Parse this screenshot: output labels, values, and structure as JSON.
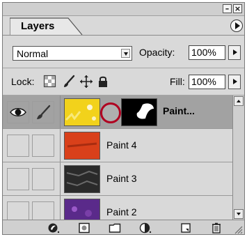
{
  "panel": {
    "tab_label": "Layers",
    "blend_mode": "Normal",
    "opacity_label": "Opacity:",
    "opacity_value": "100%",
    "lock_label": "Lock:",
    "fill_label": "Fill:",
    "fill_value": "100%"
  },
  "layers": [
    {
      "name": "Paint...",
      "selected": true,
      "visible": true,
      "linked": true,
      "thumb_color": "#f2d21b"
    },
    {
      "name": "Paint 4",
      "selected": false,
      "visible": false,
      "linked": false,
      "thumb_color": "#d9401a"
    },
    {
      "name": "Paint 3",
      "selected": false,
      "visible": false,
      "linked": false,
      "thumb_color": "#2a2a2a"
    },
    {
      "name": "Paint 2",
      "selected": false,
      "visible": false,
      "linked": false,
      "thumb_color": "#5a2a8a"
    }
  ],
  "colors": {
    "panel_bg": "#d9d9d9",
    "selected_row": "#a2a2a2",
    "highlight": "#b00020"
  },
  "icons": {
    "lock_transparency": "checkerboard-icon",
    "lock_image": "brush-icon",
    "lock_position": "move-icon",
    "lock_all": "padlock-icon",
    "toolbar": [
      "layer-style-icon",
      "add-mask-icon",
      "new-set-icon",
      "adjustment-layer-icon",
      "new-layer-icon",
      "trash-icon"
    ]
  }
}
